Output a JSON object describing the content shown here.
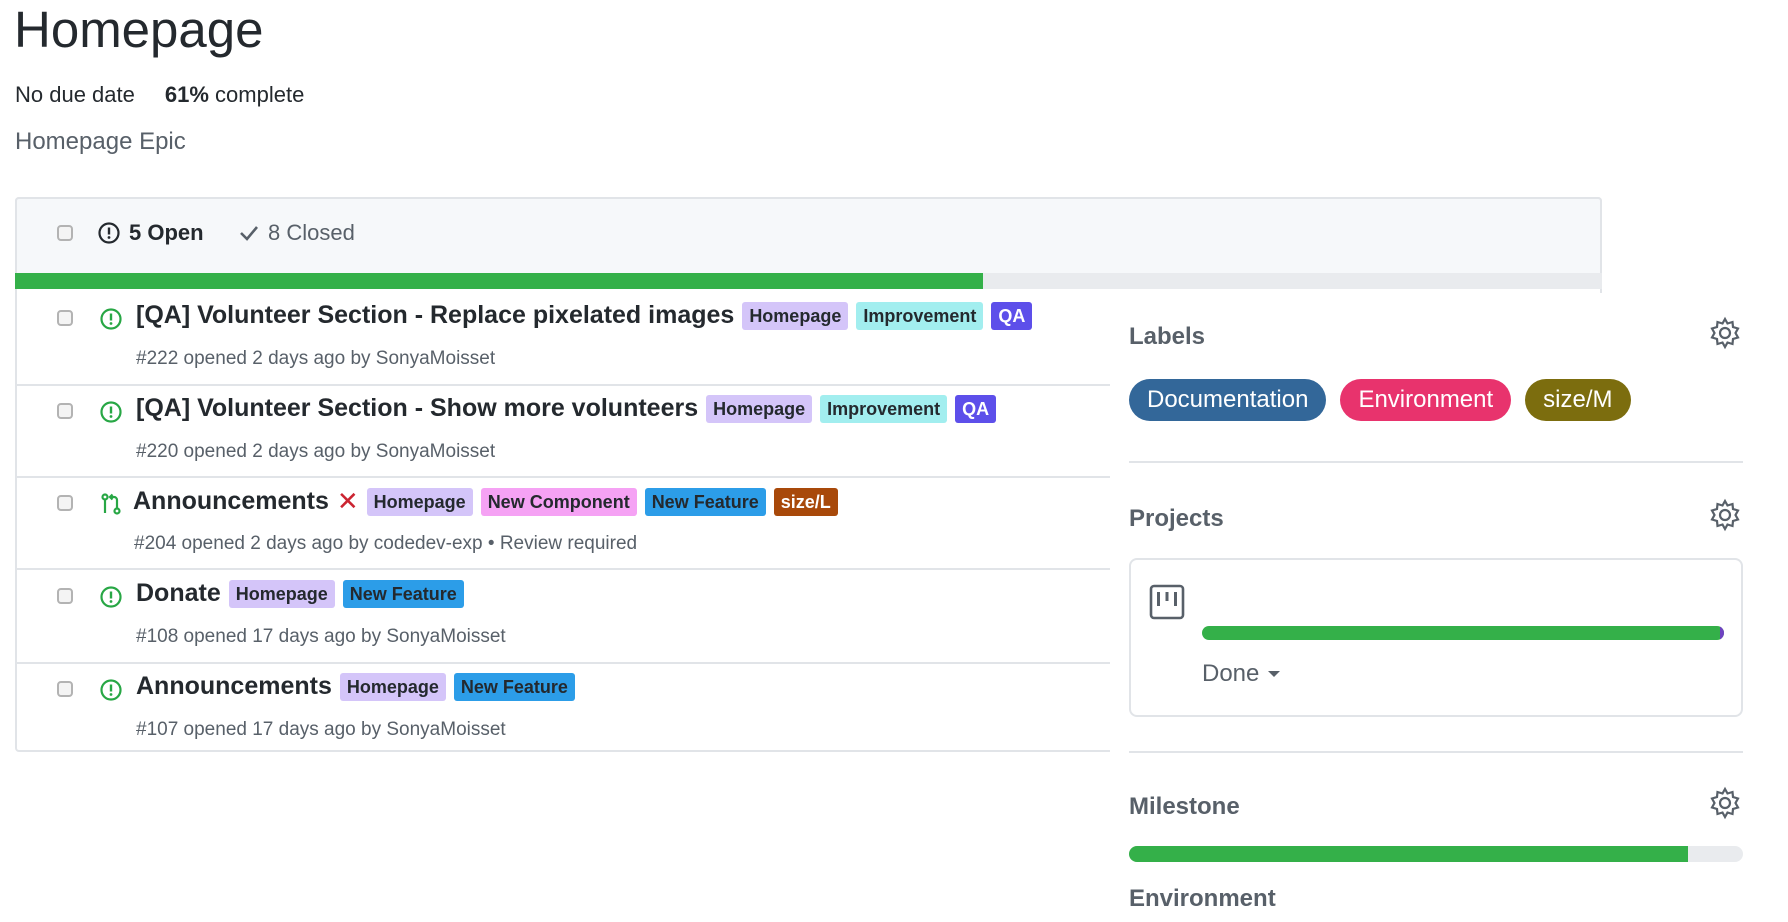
{
  "page": {
    "title": "Homepage",
    "due": "No due date",
    "percent": "61%",
    "percent_suffix": " complete",
    "epic": "Homepage Epic"
  },
  "list": {
    "open_label": "5 Open",
    "closed_label": "8 Closed",
    "progress_fraction": 0.61,
    "accent": "#34b049"
  },
  "issues": [
    {
      "title": "[QA] Volunteer Section - Replace pixelated images",
      "sub": "#222 opened 2 days ago by SonyaMoisset",
      "icon": "issue-open-icon",
      "labels": [
        {
          "text": "Homepage",
          "bg": "#d4c5f9",
          "fg": "#24292e"
        },
        {
          "text": "Improvement",
          "bg": "#a2eeef",
          "fg": "#24292e"
        },
        {
          "text": "QA",
          "bg": "#5d4fea",
          "fg": "#ffffff"
        }
      ]
    },
    {
      "title": "[QA] Volunteer Section - Show more volunteers",
      "sub": "#220 opened 2 days ago by SonyaMoisset",
      "icon": "issue-open-icon",
      "labels": [
        {
          "text": "Homepage",
          "bg": "#d4c5f9",
          "fg": "#24292e"
        },
        {
          "text": "Improvement",
          "bg": "#a2eeef",
          "fg": "#24292e"
        },
        {
          "text": "QA",
          "bg": "#5d4fea",
          "fg": "#ffffff"
        }
      ]
    },
    {
      "title": "Announcements",
      "sub": "#204 opened 2 days ago by codedev-exp • Review required",
      "icon": "pull-request-icon",
      "failed": "✕",
      "labels": [
        {
          "text": "Homepage",
          "bg": "#d4c5f9",
          "fg": "#24292e"
        },
        {
          "text": "New Component",
          "bg": "#f5a2f4",
          "fg": "#24292e"
        },
        {
          "text": "New Feature",
          "bg": "#2c9de8",
          "fg": "#24292e"
        },
        {
          "text": "size/L",
          "bg": "#a8490a",
          "fg": "#ffffff"
        }
      ]
    },
    {
      "title": "Donate",
      "sub": "#108 opened 17 days ago by SonyaMoisset",
      "icon": "issue-open-icon",
      "labels": [
        {
          "text": "Homepage",
          "bg": "#d4c5f9",
          "fg": "#24292e"
        },
        {
          "text": "New Feature",
          "bg": "#2c9de8",
          "fg": "#24292e"
        }
      ]
    },
    {
      "title": "Announcements",
      "sub": "#107 opened 17 days ago by SonyaMoisset",
      "icon": "issue-open-icon",
      "labels": [
        {
          "text": "Homepage",
          "bg": "#d4c5f9",
          "fg": "#24292e"
        },
        {
          "text": "New Feature",
          "bg": "#2c9de8",
          "fg": "#24292e"
        }
      ]
    }
  ],
  "sidebar": {
    "labels_heading": "Labels",
    "labels": [
      {
        "text": "Documentation",
        "bg": "#336799"
      },
      {
        "text": "Environment",
        "bg": "#e8336d"
      },
      {
        "text": "size/M",
        "bg": "#7c6d0e"
      }
    ],
    "projects_heading": "Projects",
    "project_progress": 1.0,
    "project_status": "Done",
    "milestone_heading": "Milestone",
    "milestone_progress": 0.91,
    "environment_heading": "Environment"
  }
}
